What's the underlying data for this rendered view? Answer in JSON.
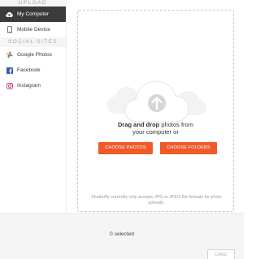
{
  "sidebar": {
    "upload_label": "UPLOAD",
    "social_label": "SOCIAL SITES",
    "upload_items": [
      {
        "label": "My Computer",
        "icon": "cloud-upload-icon",
        "active": true
      },
      {
        "label": "Mobile Device",
        "icon": "mobile-device-icon",
        "active": false
      }
    ],
    "social_items": [
      {
        "label": "Google Photos",
        "icon": "google-photos-icon"
      },
      {
        "label": "Facebook",
        "icon": "facebook-icon"
      },
      {
        "label": "Instagram",
        "icon": "instagram-icon"
      }
    ]
  },
  "dropzone": {
    "title_bold": "Drag and drop",
    "title_rest": " photos from",
    "title_line2": "your computer or",
    "choose_photos_label": "CHOOSE PHOTOS",
    "choose_folders_label": "CHOOSE FOLDERS",
    "note": "Shutterfly currently only accepts JPG or JPEG file formats for photo uploads."
  },
  "footer": {
    "selected_text": "0 selected",
    "button_label": "CANC"
  },
  "colors": {
    "accent": "#f05a28",
    "active_nav": "#3b3b3b",
    "facebook": "#3b5998",
    "instagram": "#c13584"
  }
}
